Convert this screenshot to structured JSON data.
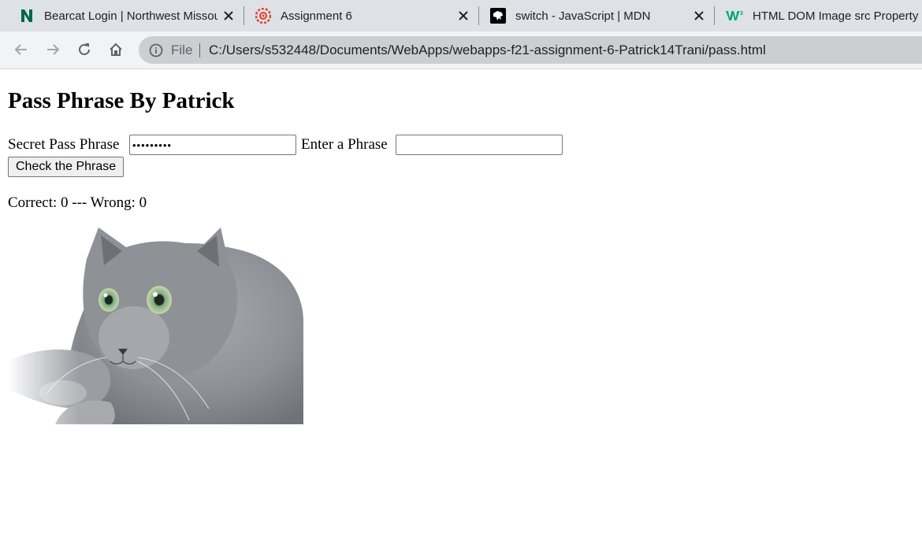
{
  "browser": {
    "tabs": [
      {
        "title": "Bearcat Login | Northwest Missou",
        "favicon": "northwest-n-icon"
      },
      {
        "title": "Assignment 6",
        "favicon": "canvas-icon"
      },
      {
        "title": "switch - JavaScript | MDN",
        "favicon": "mdn-dino-icon"
      },
      {
        "title": "HTML DOM Image src Property",
        "favicon": "w3schools-icon"
      }
    ],
    "omnibox": {
      "label": "File",
      "url": "C:/Users/s532448/Documents/WebApps/webapps-f21-assignment-6-Patrick14Trani/pass.html"
    }
  },
  "page": {
    "heading": "Pass Phrase By Patrick",
    "secret_label": "Secret Pass Phrase",
    "secret_value": "•••••••••",
    "enter_label": "Enter a Phrase",
    "enter_value": "",
    "check_button": "Check the Phrase",
    "score_text": "Correct: 0 --- Wrong: 0",
    "image_subject": "gray-cat-image"
  },
  "colors": {
    "tabstrip": "#dee1e6",
    "toolbar": "#f1f3f4",
    "omnibox": "#ccced1",
    "northwest_green": "#006747",
    "canvas_red": "#e13f2b",
    "w3_green": "#04aa6d"
  }
}
